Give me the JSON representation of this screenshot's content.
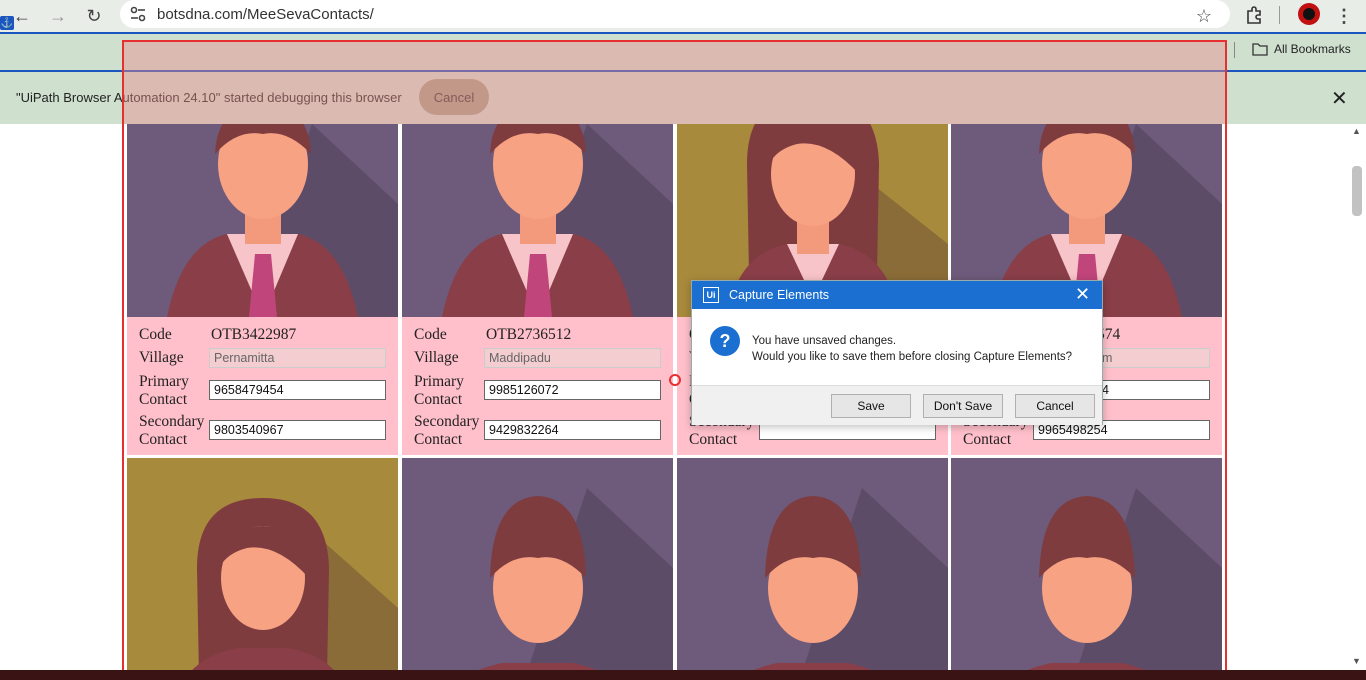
{
  "browser": {
    "url": "botsdna.com/MeeSevaContacts/",
    "bookmarks_label": "All Bookmarks",
    "infobar_text": "\"UiPath Browser Automation 24.10\" started debugging this browser",
    "infobar_cancel": "Cancel"
  },
  "labels": {
    "code": "Code",
    "village": "Village",
    "primary1": "Primary",
    "primary2": "Contact",
    "secondary1": "Secondary",
    "secondary2": "Contact"
  },
  "cards_row1": [
    {
      "code": "OTB3422987",
      "village": "Pernamitta",
      "primary": "9658479454",
      "secondary": "9803540967",
      "avatar": "man-avatar"
    },
    {
      "code": "OTB2736512",
      "village": "Maddipadu",
      "primary": "9985126072",
      "secondary": "9429832264",
      "avatar": "man-avatar"
    },
    {
      "code": "",
      "village": "",
      "primary": "",
      "secondary": "",
      "avatar": "woman-avatar",
      "partial_code": "O",
      "partial_village": "V",
      "partial_primary": "P",
      "partial_secondary": "C",
      "partial_secondary_label": "Secondary",
      "partial_contact": "Contact"
    },
    {
      "code": "574",
      "village": "m",
      "primary": "4",
      "secondary": "9965498254",
      "avatar": "man-avatar",
      "partial_secondary_label": "Secondary"
    }
  ],
  "cards_row2": [
    {
      "avatar": "woman-avatar"
    },
    {
      "avatar": "man-avatar"
    },
    {
      "avatar": "man-avatar"
    },
    {
      "avatar": "man-avatar"
    }
  ],
  "dialog": {
    "title": "Capture Elements",
    "logo": "Ui",
    "message_line1": "You have unsaved changes.",
    "message_line2": "Would you like to save them before closing Capture Elements?",
    "save": "Save",
    "dont_save": "Don't Save",
    "cancel": "Cancel"
  },
  "colors": {
    "card_info_bg": "#ffc0cb",
    "man_bg": "#6e5a7a",
    "woman_bg": "#a88a3c",
    "highlight": "#e63030",
    "dialog_accent": "#1a6fd0"
  }
}
